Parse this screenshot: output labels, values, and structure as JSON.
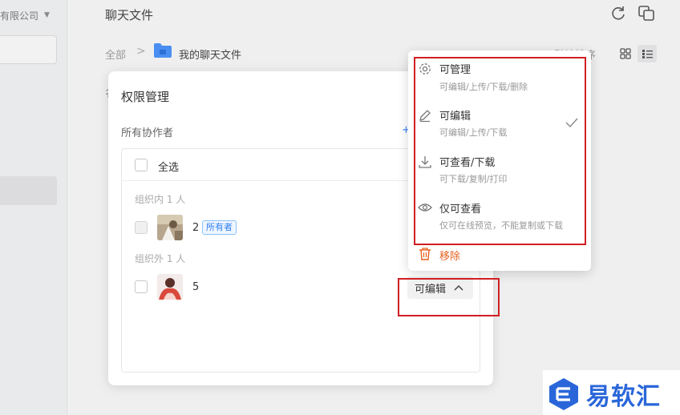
{
  "sidebar": {
    "org_name": "有限公司"
  },
  "header": {
    "title": "聊天文件"
  },
  "breadcrumb": {
    "root": "全部",
    "separator": ">",
    "current": "我的聊天文件"
  },
  "toolbar": {
    "sort_label": "默认排序"
  },
  "background": {
    "tab_partial": "名"
  },
  "dialog": {
    "title": "权限管理",
    "collaborators_label": "所有协作者",
    "collaborators_action": "+",
    "select_all_label": "全选",
    "groups": [
      {
        "label": "组织内 1 人",
        "members": [
          {
            "name": "2",
            "badge": "所有者"
          }
        ]
      },
      {
        "label": "组织外 1 人",
        "members": [
          {
            "name": "5",
            "permission": "可编辑"
          }
        ]
      }
    ]
  },
  "permission_menu": {
    "items": [
      {
        "title": "可管理",
        "desc": "可编辑/上传/下载/删除",
        "icon": "gear-icon",
        "selected": false
      },
      {
        "title": "可编辑",
        "desc": "可编辑/上传/下载",
        "icon": "pencil-icon",
        "selected": true
      },
      {
        "title": "可查看/下载",
        "desc": "可下载/复制/打印",
        "icon": "download-icon",
        "selected": false
      },
      {
        "title": "仅可查看",
        "desc": "仅可在线预览，不能复制或下载",
        "icon": "eye-icon",
        "selected": false
      }
    ],
    "remove_label": "移除",
    "remove_icon": "trash-icon"
  },
  "watermark": {
    "text": "易软汇"
  },
  "colors": {
    "accent": "#2f7ef5",
    "highlight": "#d01f24",
    "remove": "#e7621f",
    "watermark": "#2a66d9"
  }
}
